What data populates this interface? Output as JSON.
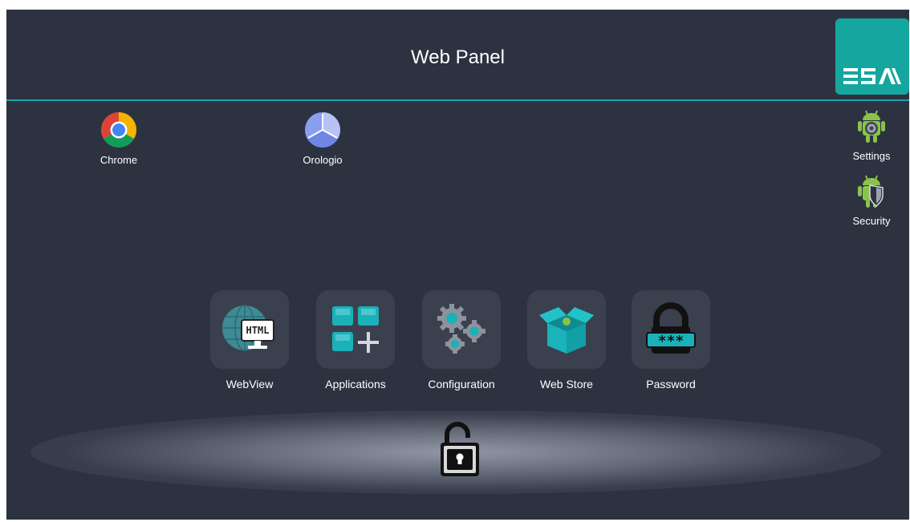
{
  "header": {
    "title": "Web Panel",
    "logo": "ESA"
  },
  "colors": {
    "background": "#2d3241",
    "accent": "#16a6ad",
    "tile": "#3b404f",
    "logo_bg": "#15a6a0"
  },
  "desktop_icons": [
    {
      "label": "Chrome",
      "icon": "chrome-icon"
    },
    {
      "label": "Orologio",
      "icon": "clock-icon"
    }
  ],
  "side_icons": [
    {
      "label": "Settings",
      "icon": "android-settings-icon"
    },
    {
      "label": "Security",
      "icon": "android-security-icon"
    }
  ],
  "dock": [
    {
      "label": "WebView",
      "icon": "html-globe-icon"
    },
    {
      "label": "Applications",
      "icon": "applications-grid-icon"
    },
    {
      "label": "Configuration",
      "icon": "gears-icon"
    },
    {
      "label": "Web Store",
      "icon": "store-box-icon"
    },
    {
      "label": "Password",
      "icon": "password-lock-icon"
    }
  ],
  "lock_icon": "unlocked-padlock-icon"
}
